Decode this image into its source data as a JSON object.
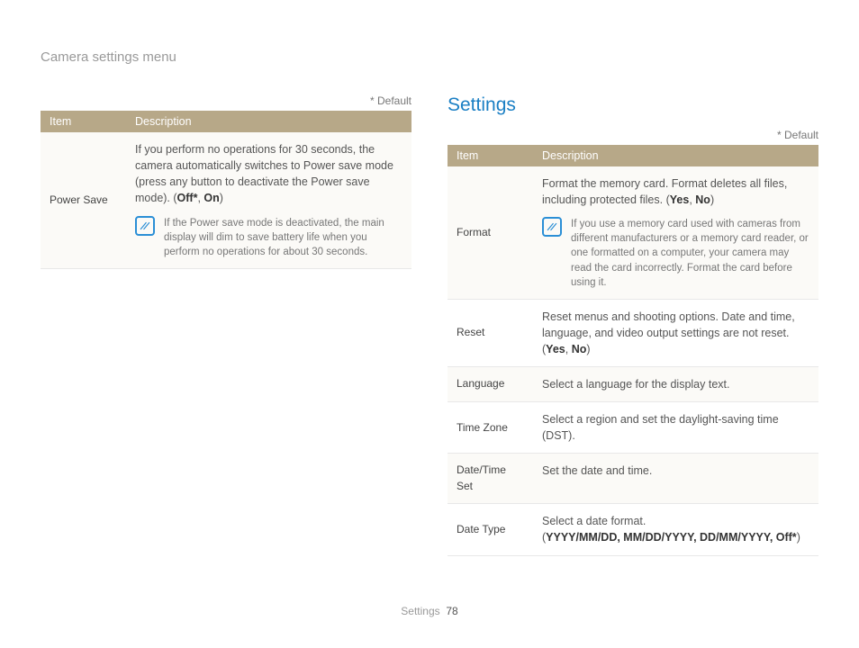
{
  "breadcrumb": "Camera settings menu",
  "default_note": "* Default",
  "headers": {
    "item": "Item",
    "description": "Description"
  },
  "left_table": {
    "rows": [
      {
        "item": "Power Save",
        "desc_pre": "If you perform no operations for 30 seconds, the camera automatically switches to Power save mode (press any button to deactivate the Power save mode). (",
        "opt1": "Off*",
        "sep": ", ",
        "opt2": "On",
        "desc_post": ")",
        "note": "If the Power save mode is deactivated, the main display will dim to save battery life when you perform no operations for about 30 seconds."
      }
    ]
  },
  "right_section_title": "Settings",
  "right_table": {
    "rows": [
      {
        "item": "Format",
        "desc_pre": "Format the memory card. Format deletes all files, including protected files. (",
        "opt1": "Yes",
        "sep": ", ",
        "opt2": "No",
        "desc_post": ")",
        "note": "If you use a memory card used with cameras from different manufacturers or a memory card reader, or one formatted on a computer, your camera may read the card incorrectly. Format the card before using it."
      },
      {
        "item": "Reset",
        "desc_pre": "Reset menus and shooting options. Date and time, language, and video output settings are not reset. (",
        "opt1": "Yes",
        "sep": ", ",
        "opt2": "No",
        "desc_post": ")"
      },
      {
        "item": "Language",
        "desc_plain": "Select a language for the display text."
      },
      {
        "item": "Time Zone",
        "desc_plain": "Select a region and set the daylight-saving time (DST)."
      },
      {
        "item": "Date/Time Set",
        "desc_plain": "Set the date and time."
      },
      {
        "item": "Date Type",
        "desc_line1": "Select a date format.",
        "opts_open": "(",
        "opts": "YYYY/MM/DD, MM/DD/YYYY, DD/MM/YYYY, Off*",
        "opts_close": ")"
      }
    ]
  },
  "footer": {
    "section": "Settings",
    "page": "78"
  }
}
